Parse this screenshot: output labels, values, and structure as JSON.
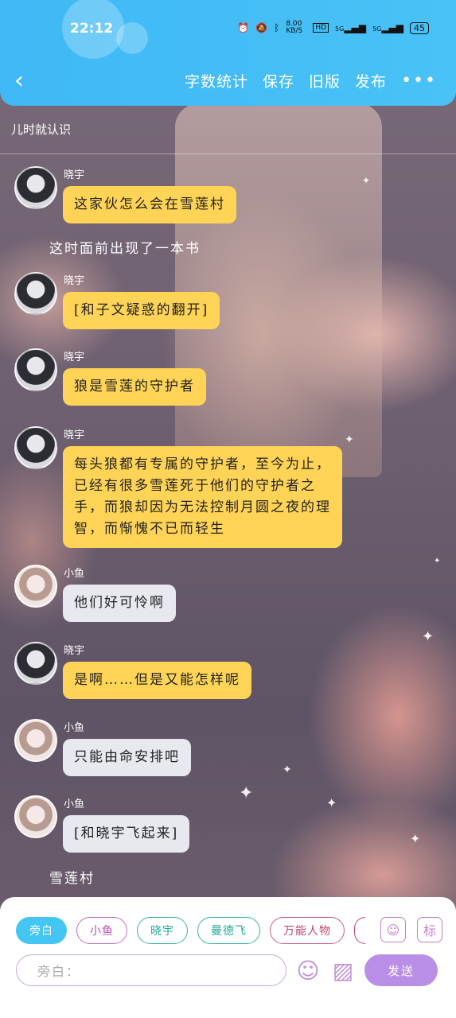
{
  "status_bar": {
    "time": "22:12",
    "net_speed": "8.00 KB/S",
    "signal_1": "5G",
    "signal_2": "5G",
    "battery": "45",
    "hd": "HD"
  },
  "header": {
    "back_icon": "chevron-left-icon",
    "menu": [
      "字数统计",
      "保存",
      "旧版",
      "发布"
    ],
    "more_icon": "more-dots-icon",
    "bg_color": "#3fb8f5"
  },
  "chapter_title": "儿时就认识",
  "messages": [
    {
      "sender": "晓宇",
      "text": "这家伙怎么会在雪莲村"
    },
    {
      "narration": "这时面前出现了一本书"
    },
    {
      "sender": "晓宇",
      "text": "[和子文疑惑的翻开]"
    },
    {
      "sender": "晓宇",
      "text": "狼是雪莲的守护者"
    },
    {
      "sender": "晓宇",
      "text": "每头狼都有专属的守护者，至今为止，已经有很多雪莲死于他们的守护者之手，而狼却因为无法控制月圆之夜的理智，而惭愧不已而轻生"
    },
    {
      "sender": "小鱼",
      "text": "他们好可怜啊"
    },
    {
      "sender": "晓宇",
      "text": "是啊……但是又能怎样呢"
    },
    {
      "sender": "小鱼",
      "text": "只能由命安排吧"
    },
    {
      "sender": "小鱼",
      "text": "[和晓宇飞起来]"
    },
    {
      "narration": "雪莲村"
    }
  ],
  "roles": [
    "旁白",
    "小鱼",
    "晓宇",
    "曼德飞",
    "万能人物"
  ],
  "role_icon_1": "person-card-icon",
  "role_icon_2": "标",
  "input": {
    "placeholder": "旁白："
  },
  "emoji_icon": "emoji-icon",
  "image_icon": "image-icon",
  "send_label": "发送"
}
